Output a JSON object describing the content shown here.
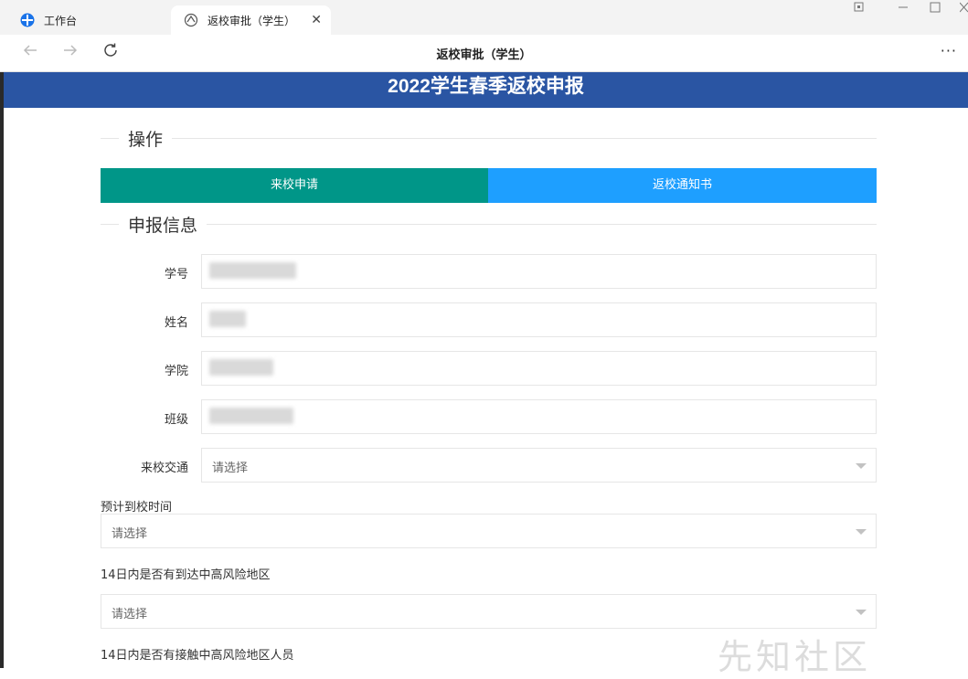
{
  "browser": {
    "tabs": [
      {
        "label": "工作台"
      },
      {
        "label": "返校审批（学生）",
        "close": "✕"
      }
    ],
    "nav_title": "返校审批（学生）",
    "more": "···"
  },
  "header": {
    "title": "2022学生春季返校申报"
  },
  "sections": {
    "operations": "操作",
    "info": "申报信息"
  },
  "buttons": {
    "apply": "来校申请",
    "notice": "返校通知书"
  },
  "fields": {
    "student_id": "学号",
    "name": "姓名",
    "college": "学院",
    "class": "班级",
    "transport": {
      "label": "来校交通",
      "placeholder": "请选择"
    }
  },
  "questions": [
    {
      "label": "预计到校时间",
      "placeholder": "请选择"
    },
    {
      "label": "14日内是否有到达中高风险地区",
      "placeholder": "请选择"
    },
    {
      "label": "14日内是否有接触中高风险地区人员"
    }
  ],
  "watermark": "先知社区",
  "colors": {
    "header": "#2a55a3",
    "apply_button": "#009688",
    "notice_button": "#1e9fff"
  }
}
